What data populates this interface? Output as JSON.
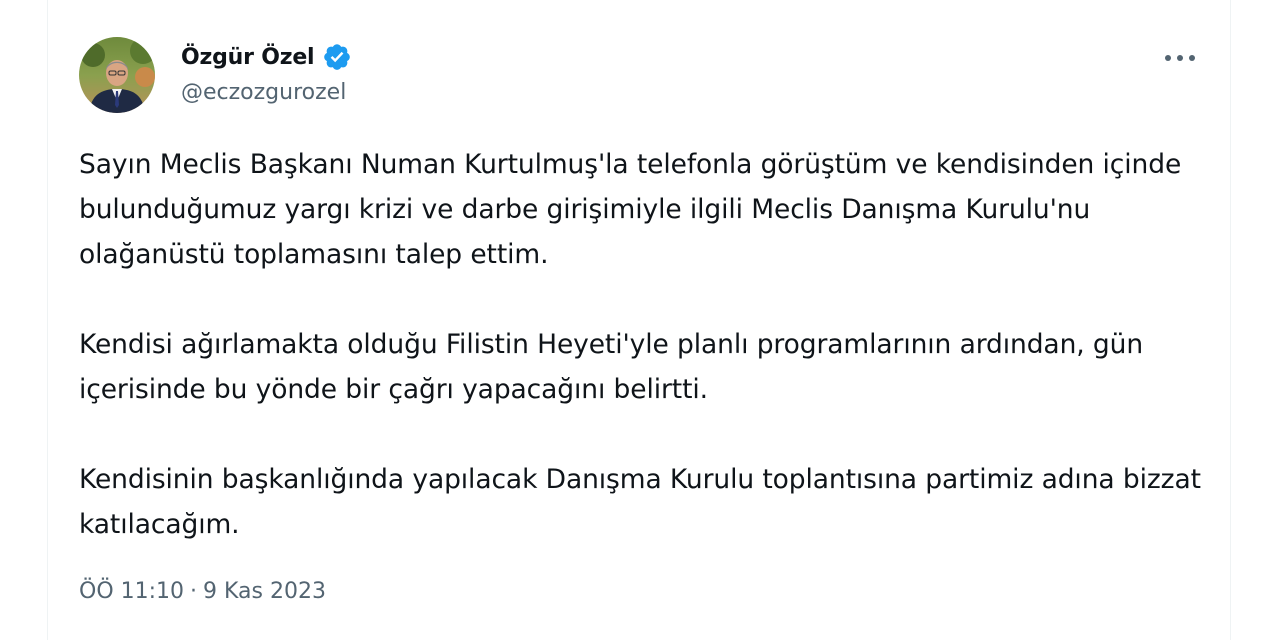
{
  "author": {
    "display_name": "Özgür Özel",
    "handle": "@eczozgurozel",
    "verified": true
  },
  "tweet": {
    "paragraphs": [
      "Sayın Meclis Başkanı Numan Kurtulmuş'la telefonla görüştüm ve kendisinden içinde bulunduğumuz yargı krizi ve darbe girişimiyle ilgili Meclis Danışma Kurulu'nu olağanüstü toplamasını talep ettim.",
      "Kendisi ağırlamakta olduğu Filistin Heyeti'yle planlı programlarının ardından, gün içerisinde bu yönde bir çağrı yapacağını belirtti.",
      "Kendisinin başkanlığında yapılacak Danışma Kurulu toplantısına partimiz adına bizzat katılacağım."
    ],
    "time": "ÖÖ 11:10",
    "separator": "·",
    "date": "9 Kas 2023"
  },
  "icons": {
    "verified": "verified-badge-icon",
    "more": "more-horizontal-icon"
  },
  "colors": {
    "text": "#0f1419",
    "secondary": "#536471",
    "verified_blue": "#1d9bf0",
    "border": "#eff3f4"
  }
}
